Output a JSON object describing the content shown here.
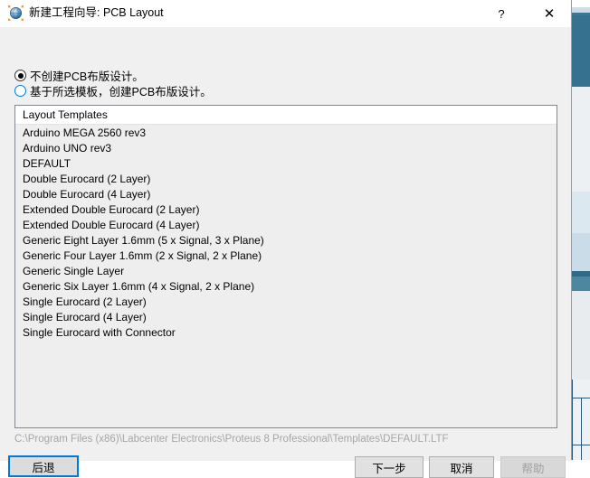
{
  "window": {
    "title": "新建工程向导: PCB Layout",
    "icon": "globe-icon",
    "help_button": "?",
    "close_button": "✕"
  },
  "options": [
    {
      "label": "不创建PCB布版设计。",
      "selected": true
    },
    {
      "label": "基于所选模板，创建PCB布版设计。",
      "selected": false
    }
  ],
  "list": {
    "header": "Layout Templates",
    "items": [
      "Arduino MEGA 2560 rev3",
      "Arduino UNO rev3",
      "DEFAULT",
      "Double Eurocard (2 Layer)",
      "Double Eurocard (4 Layer)",
      "Extended Double Eurocard (2 Layer)",
      "Extended Double Eurocard (4 Layer)",
      "Generic Eight Layer 1.6mm (5 x Signal, 3 x Plane)",
      "Generic Four Layer 1.6mm (2 x Signal, 2 x Plane)",
      "Generic Single Layer",
      "Generic Six Layer 1.6mm (4 x Signal, 2 x Plane)",
      "Single Eurocard (2 Layer)",
      "Single Eurocard (4 Layer)",
      "Single Eurocard with Connector"
    ]
  },
  "path": "C:\\Program Files (x86)\\Labcenter Electronics\\Proteus 8 Professional\\Templates\\DEFAULT.LTF",
  "buttons": {
    "back": "后退",
    "next": "下一步",
    "cancel": "取消",
    "help": "帮助"
  },
  "colors": {
    "accent": "#0078d7",
    "dialog_bg": "#f0f0f0",
    "list_bg": "#eeeeee",
    "path_text": "#a6a6a6"
  }
}
